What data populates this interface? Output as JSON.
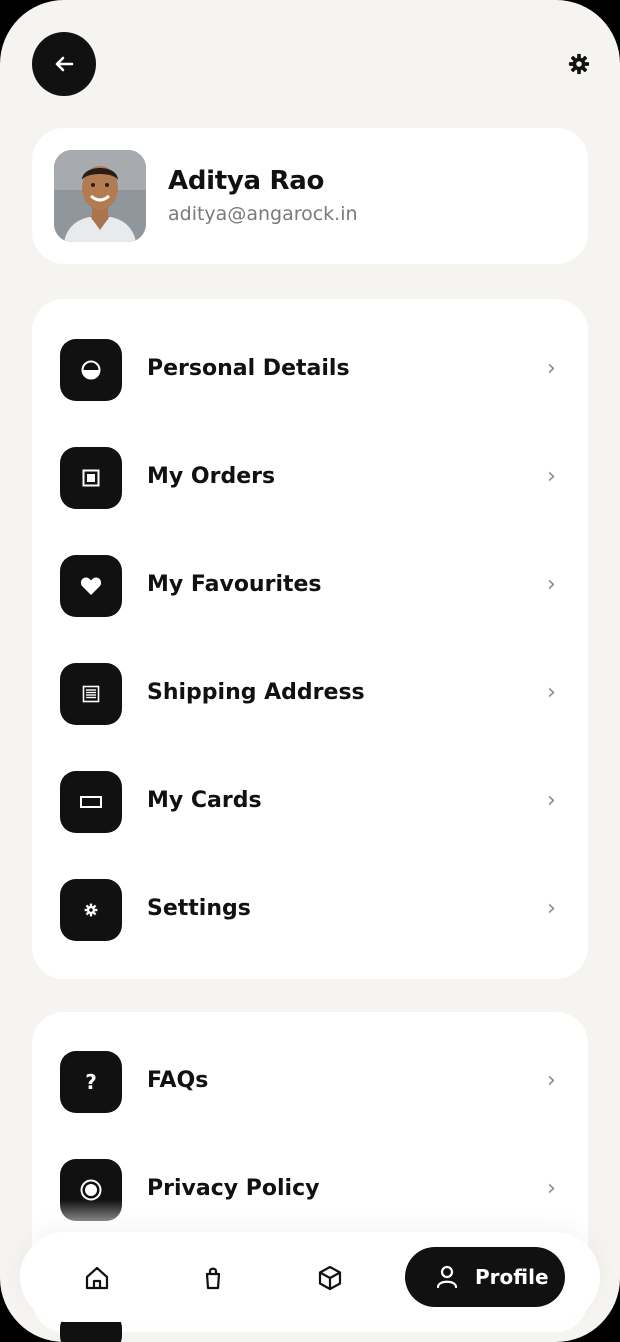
{
  "header": {
    "back_icon": "arrow-left-icon",
    "settings_icon": "gear-icon"
  },
  "profile": {
    "name": "Aditya Rao",
    "email": "aditya@angarock.in"
  },
  "menu_primary": [
    {
      "label": "Personal Details",
      "icon": "half-circle-icon"
    },
    {
      "label": "My Orders",
      "icon": "box-icon"
    },
    {
      "label": "My Favourites",
      "icon": "heart-icon"
    },
    {
      "label": "Shipping Address",
      "icon": "document-icon"
    },
    {
      "label": "My Cards",
      "icon": "card-icon"
    },
    {
      "label": "Settings",
      "icon": "gear-icon"
    }
  ],
  "menu_secondary": [
    {
      "label": "FAQs",
      "icon": "question-icon"
    },
    {
      "label": "Privacy Policy",
      "icon": "radio-icon"
    }
  ],
  "chevron": "›",
  "tabbar": {
    "tabs": [
      {
        "icon": "home-icon"
      },
      {
        "icon": "bag-icon"
      },
      {
        "icon": "cube-icon"
      }
    ],
    "active": {
      "label": "Profile",
      "icon": "user-icon"
    }
  }
}
